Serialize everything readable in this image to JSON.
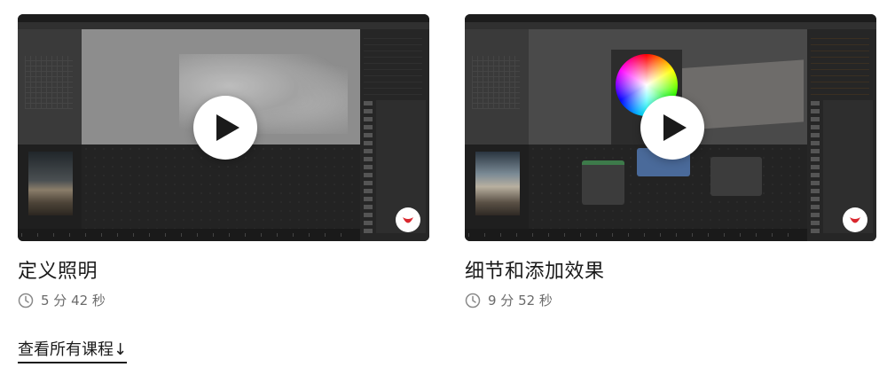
{
  "courses": [
    {
      "title": "定义照明",
      "duration": "5 分 42 秒",
      "play_icon": "play-icon",
      "clock_icon": "clock-icon"
    },
    {
      "title": "细节和添加效果",
      "duration": "9 分 52 秒",
      "play_icon": "play-icon",
      "clock_icon": "clock-icon"
    }
  ],
  "footer": {
    "view_all": "查看所有课程↓"
  },
  "colors": {
    "accent_logo": "#d9272e",
    "text": "#1a1a1a",
    "muted": "#6b6b6b"
  }
}
